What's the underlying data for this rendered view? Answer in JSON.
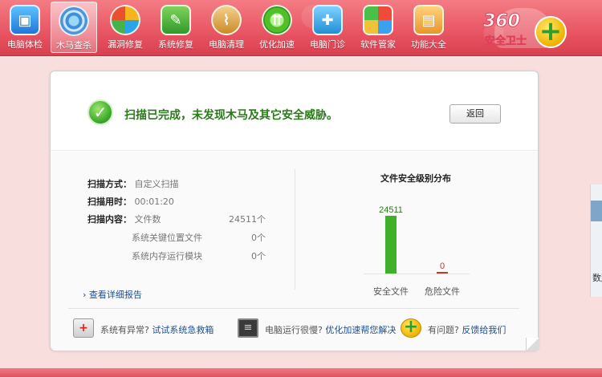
{
  "toolbar": {
    "items": [
      {
        "label": "电脑体检",
        "icon": "monitor-icon"
      },
      {
        "label": "木马查杀",
        "icon": "trojan-shield-icon"
      },
      {
        "label": "漏洞修复",
        "icon": "patch-icon"
      },
      {
        "label": "系统修复",
        "icon": "wrench-icon"
      },
      {
        "label": "电脑清理",
        "icon": "broom-icon"
      },
      {
        "label": "优化加速",
        "icon": "speedup-icon"
      },
      {
        "label": "电脑门诊",
        "icon": "clinic-icon"
      },
      {
        "label": "软件管家",
        "icon": "software-icon"
      },
      {
        "label": "功能大全",
        "icon": "toolbox-icon"
      }
    ],
    "active_index": 1
  },
  "brand": {
    "line1": "360",
    "line2": "安全卫士"
  },
  "scan": {
    "headline": "扫描已完成，未发现木马及其它安全威胁。",
    "back_button": "返回",
    "mode_label": "扫描方式：",
    "mode_value": "自定义扫描",
    "time_label": "扫描用时：",
    "time_value": "00:01:20",
    "content_label": "扫描内容：",
    "content_items": [
      {
        "name": "文件数",
        "count": "24511个"
      },
      {
        "name": "系统关键位置文件",
        "count": "0个"
      },
      {
        "name": "系统内存运行模块",
        "count": "0个"
      }
    ],
    "detail_link": "查看详细报告"
  },
  "chart_data": {
    "type": "bar",
    "title": "文件安全级别分布",
    "categories": [
      "安全文件",
      "危险文件"
    ],
    "values": [
      24511,
      0
    ],
    "value_labels": [
      "24511",
      "0"
    ],
    "colors": [
      "#3fb02a",
      "#c0392b"
    ]
  },
  "footer": {
    "items": [
      {
        "question": "系统有异常?",
        "link": "试试系统急救箱",
        "icon": "first-aid-kit-icon"
      },
      {
        "question": "电脑运行很慢?",
        "link": "优化加速帮您解决",
        "icon": "terminal-icon"
      },
      {
        "question": "有问题?",
        "link": "反馈给我们",
        "icon": "help-plus-icon"
      }
    ]
  },
  "side": {
    "clipped_text": "数起"
  }
}
